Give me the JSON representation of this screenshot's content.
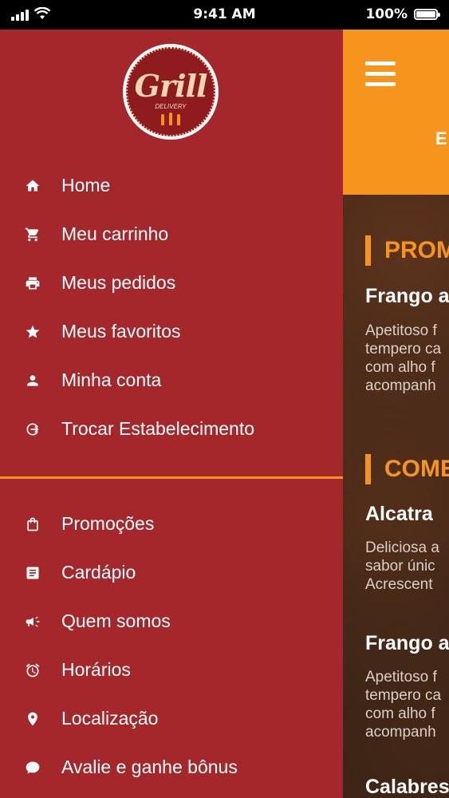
{
  "status_bar": {
    "time": "9:41 AM",
    "battery": "100%"
  },
  "drawer": {
    "logo": {
      "text": "Grill",
      "sub": "DELIVERY"
    },
    "primary_items": [
      {
        "label": "Home",
        "icon": "home-icon"
      },
      {
        "label": "Meu carrinho",
        "icon": "cart-icon"
      },
      {
        "label": "Meus pedidos",
        "icon": "printer-icon"
      },
      {
        "label": "Meus favoritos",
        "icon": "star-icon"
      },
      {
        "label": "Minha conta",
        "icon": "person-icon"
      },
      {
        "label": "Trocar Estabelecimento",
        "icon": "switch-icon"
      }
    ],
    "secondary_items": [
      {
        "label": "Promoções",
        "icon": "shopping-bag-icon"
      },
      {
        "label": "Cardápio",
        "icon": "menu-document-icon"
      },
      {
        "label": "Quem somos",
        "icon": "megaphone-icon"
      },
      {
        "label": "Horários",
        "icon": "alarm-clock-icon"
      },
      {
        "label": "Localização",
        "icon": "location-pin-icon"
      },
      {
        "label": "Avalie e ganhe bônus",
        "icon": "chat-bubble-icon"
      }
    ]
  },
  "main": {
    "header_letter": "E",
    "sections": [
      {
        "title": "PROM",
        "items": [
          {
            "title": "Frango a",
            "desc": [
              "Apetitoso f",
              "tempero ca",
              "com alho f",
              "acompanh"
            ]
          }
        ]
      },
      {
        "title": "COME",
        "items": [
          {
            "title": "Alcatra",
            "desc": [
              "Deliciosa a",
              "sabor únic",
              "Acrescent"
            ]
          },
          {
            "title": "Frango a",
            "desc": [
              "Apetitoso f",
              "tempero ca",
              "com alho f",
              "acompanh"
            ]
          },
          {
            "title": "Calabres",
            "desc": []
          }
        ]
      }
    ]
  },
  "colors": {
    "drawer": "#a3272b",
    "accent": "#f7941d",
    "text": "#ffffff"
  }
}
